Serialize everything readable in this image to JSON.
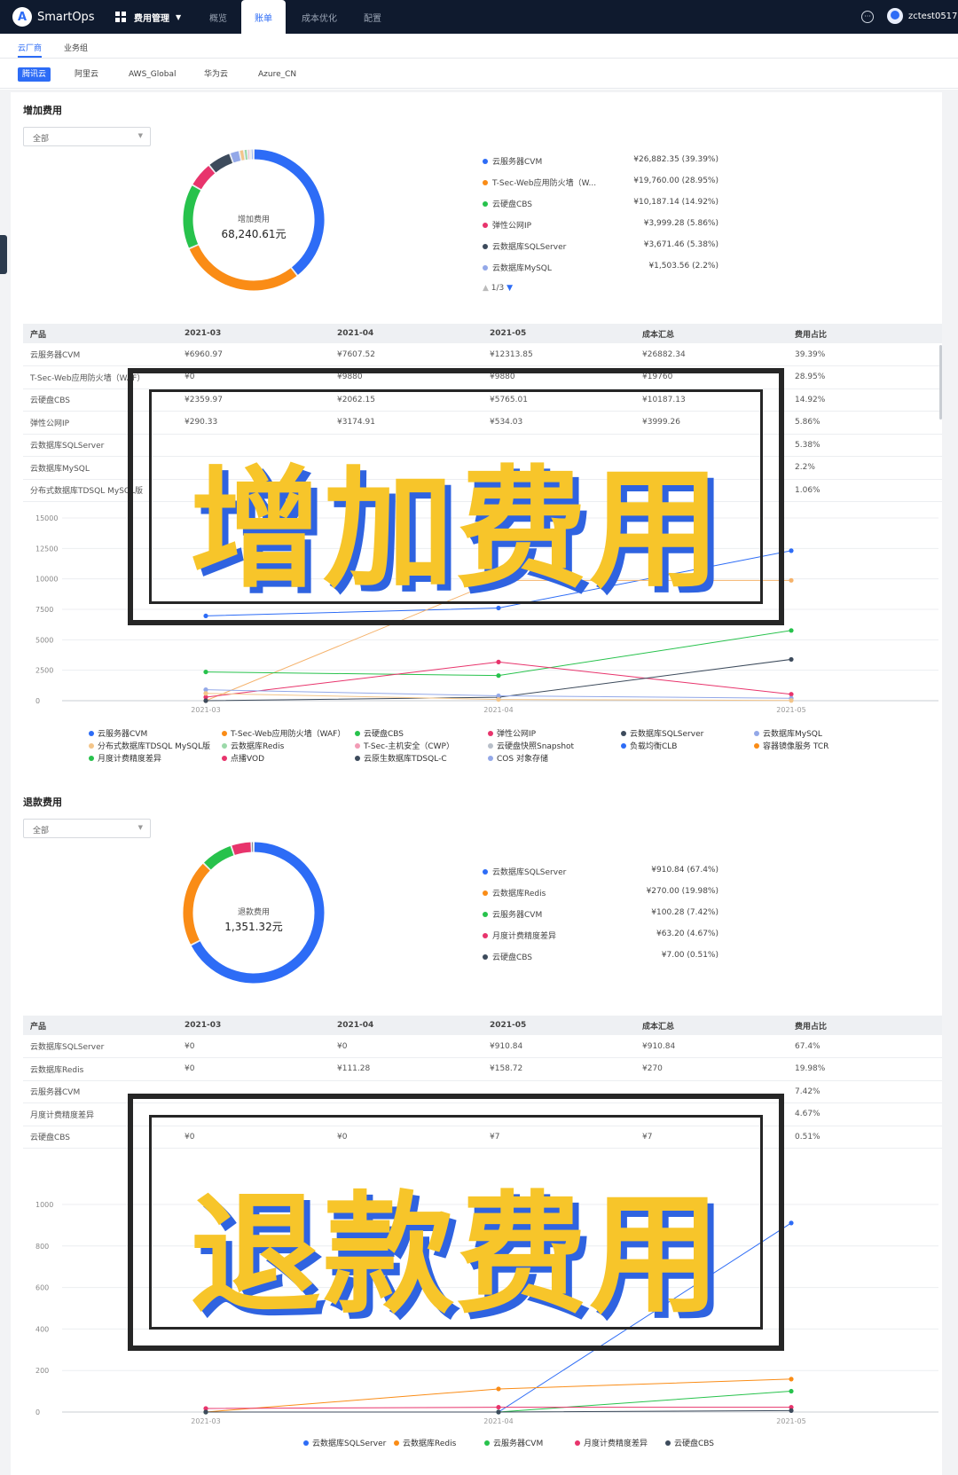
{
  "app": {
    "name": "SmartOps",
    "logo_letter": "A"
  },
  "topnav": {
    "menu_label": "费用管理",
    "items": [
      "概览",
      "账单",
      "成本优化",
      "配置"
    ],
    "active": "账单",
    "user": "zctest0517"
  },
  "subtabs": {
    "items": [
      "云厂商",
      "业务组"
    ],
    "active": "云厂商"
  },
  "vendors": {
    "items": [
      "腾讯云",
      "阿里云",
      "AWS_Global",
      "华为云",
      "Azure_CN"
    ],
    "active": "腾讯云"
  },
  "increase": {
    "title": "增加费用",
    "filter": "全部",
    "donut_title": "增加费用",
    "donut_total": "68,240.61元",
    "legend": [
      {
        "name": "云服务器CVM",
        "value": "¥26,882.35 (39.39%)",
        "color": "#2d6cf6"
      },
      {
        "name": "T-Sec-Web应用防火墙（W...",
        "value": "¥19,760.00 (28.95%)",
        "color": "#fa8c16"
      },
      {
        "name": "云硬盘CBS",
        "value": "¥10,187.14 (14.92%)",
        "color": "#27c24c"
      },
      {
        "name": "弹性公网IP",
        "value": "¥3,999.28 (5.86%)",
        "color": "#e8346c"
      },
      {
        "name": "云数据库SQLServer",
        "value": "¥3,671.46 (5.38%)",
        "color": "#3d4b5c"
      },
      {
        "name": "云数据库MySQL",
        "value": "¥1,503.56 (2.2%)",
        "color": "#93a8e8"
      }
    ],
    "pager": "1/3",
    "table": {
      "headers": [
        "产品",
        "2021-03",
        "2021-04",
        "2021-05",
        "成本汇总",
        "费用占比"
      ],
      "rows": [
        [
          "云服务器CVM",
          "¥6960.97",
          "¥7607.52",
          "¥12313.85",
          "¥26882.34",
          "39.39%"
        ],
        [
          "T-Sec-Web应用防火墙（WAF）",
          "¥0",
          "¥9880",
          "¥9880",
          "¥19760",
          "28.95%"
        ],
        [
          "云硬盘CBS",
          "¥2359.97",
          "¥2062.15",
          "¥5765.01",
          "¥10187.13",
          "14.92%"
        ],
        [
          "弹性公网IP",
          "¥290.33",
          "¥3174.91",
          "¥534.03",
          "¥3999.26",
          "5.86%"
        ],
        [
          "云数据库SQLServer",
          "",
          "",
          "",
          "",
          "5.38%"
        ],
        [
          "云数据库MySQL",
          "",
          "",
          "",
          "",
          "2.2%"
        ],
        [
          "分布式数据库TDSQL MySQL版",
          "",
          "",
          "",
          "",
          "1.06%"
        ]
      ]
    },
    "chart_legend": [
      "云服务器CVM",
      "T-Sec-Web应用防火墙（WAF）",
      "云硬盘CBS",
      "弹性公网IP",
      "云数据库SQLServer",
      "云数据库MySQL",
      "分布式数据库TDSQL MySQL版",
      "云数据库Redis",
      "T-Sec-主机安全（CWP）",
      "云硬盘快照Snapshot",
      "负载均衡CLB",
      "容器镜像服务 TCR",
      "月度计费精度差异",
      "点播VOD",
      "云原生数据库TDSQL-C",
      "COS 对象存储"
    ],
    "overlay_text": "增加费用"
  },
  "refund": {
    "title": "退款费用",
    "filter": "全部",
    "donut_title": "退款费用",
    "donut_total": "1,351.32元",
    "legend": [
      {
        "name": "云数据库SQLServer",
        "value": "¥910.84 (67.4%)",
        "color": "#2d6cf6"
      },
      {
        "name": "云数据库Redis",
        "value": "¥270.00 (19.98%)",
        "color": "#fa8c16"
      },
      {
        "name": "云服务器CVM",
        "value": "¥100.28 (7.42%)",
        "color": "#27c24c"
      },
      {
        "name": "月度计费精度差异",
        "value": "¥63.20 (4.67%)",
        "color": "#e8346c"
      },
      {
        "name": "云硬盘CBS",
        "value": "¥7.00 (0.51%)",
        "color": "#3d4b5c"
      }
    ],
    "table": {
      "headers": [
        "产品",
        "2021-03",
        "2021-04",
        "2021-05",
        "成本汇总",
        "费用占比"
      ],
      "rows": [
        [
          "云数据库SQLServer",
          "¥0",
          "¥0",
          "¥910.84",
          "¥910.84",
          "67.4%"
        ],
        [
          "云数据库Redis",
          "¥0",
          "¥111.28",
          "¥158.72",
          "¥270",
          "19.98%"
        ],
        [
          "云服务器CVM",
          "",
          "",
          "",
          "",
          "7.42%"
        ],
        [
          "月度计费精度差异",
          "",
          "",
          "",
          "",
          "4.67%"
        ],
        [
          "云硬盘CBS",
          "¥0",
          "¥0",
          "¥7",
          "¥7",
          "0.51%"
        ]
      ]
    },
    "chart_legend": [
      "云数据库SQLServer",
      "云数据库Redis",
      "云服务器CVM",
      "月度计费精度差异",
      "云硬盘CBS"
    ],
    "overlay_text": "退款费用"
  },
  "chart_data": [
    {
      "type": "line",
      "x": [
        "2021-03",
        "2021-04",
        "2021-05"
      ],
      "ylim": [
        0,
        15000
      ],
      "yticks": [
        0,
        2500,
        5000,
        7500,
        10000,
        12500,
        15000
      ],
      "series": [
        {
          "name": "云服务器CVM",
          "color": "#2d6cf6",
          "values": [
            6960.97,
            7607.52,
            12313.85
          ]
        },
        {
          "name": "T-Sec-Web应用防火墙（WAF）",
          "color": "#f5b26b",
          "values": [
            0,
            9880,
            9880
          ]
        },
        {
          "name": "云硬盘CBS",
          "color": "#27c24c",
          "values": [
            2359.97,
            2062.15,
            5765.01
          ]
        },
        {
          "name": "弹性公网IP",
          "color": "#e8346c",
          "values": [
            290.33,
            3174.91,
            534.03
          ]
        },
        {
          "name": "云数据库SQLServer",
          "color": "#3d4b5c",
          "values": [
            0,
            280,
            3391
          ]
        },
        {
          "name": "云数据库MySQL",
          "color": "#93a8e8",
          "values": [
            900,
            400,
            200
          ]
        },
        {
          "name": "分布式数据库TDSQL MySQL版",
          "color": "#f3c58a",
          "values": [
            600,
            100,
            20
          ]
        }
      ]
    },
    {
      "type": "line",
      "x": [
        "2021-03",
        "2021-04",
        "2021-05"
      ],
      "ylim": [
        0,
        1000
      ],
      "yticks": [
        0,
        200,
        400,
        600,
        800,
        1000
      ],
      "series": [
        {
          "name": "云数据库SQLServer",
          "color": "#2d6cf6",
          "values": [
            0,
            0,
            910.84
          ]
        },
        {
          "name": "云数据库Redis",
          "color": "#fa8c16",
          "values": [
            0,
            111.28,
            158.72
          ]
        },
        {
          "name": "云服务器CVM",
          "color": "#27c24c",
          "values": [
            0,
            0,
            100.28
          ]
        },
        {
          "name": "月度计费精度差异",
          "color": "#e8346c",
          "values": [
            17.1,
            23.1,
            22.9
          ]
        },
        {
          "name": "云硬盘CBS",
          "color": "#3d4b5c",
          "values": [
            0,
            0,
            7
          ]
        }
      ]
    }
  ]
}
